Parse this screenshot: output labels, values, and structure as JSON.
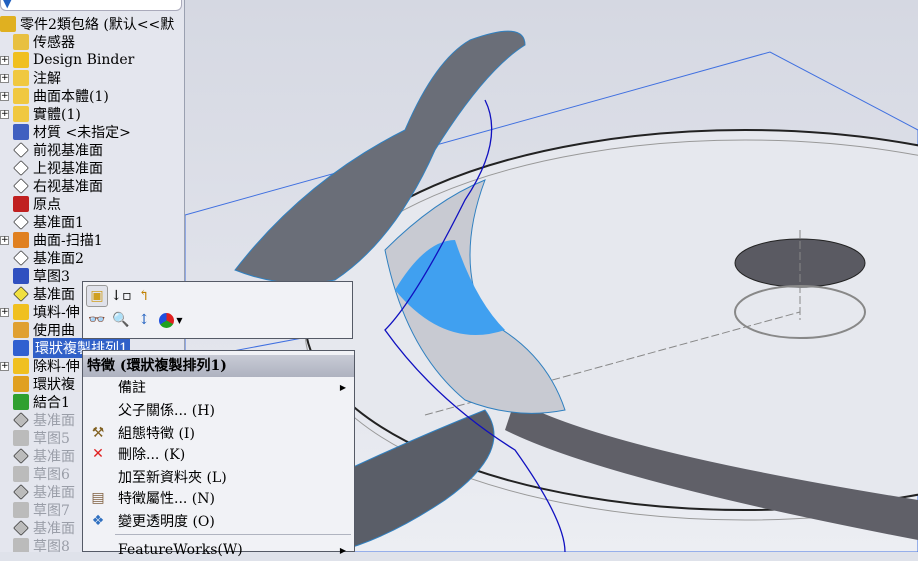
{
  "tree": {
    "root": "零件2類包絡 (默认<<默",
    "items": [
      {
        "label": "传感器",
        "plus": false,
        "icon": "sensor-icon",
        "color": "#e8c040"
      },
      {
        "label": "Design Binder",
        "plus": true,
        "icon": "design-binder-icon",
        "color": "#f0c020"
      },
      {
        "label": "注解",
        "plus": true,
        "icon": "annotations-icon",
        "color": "#f0c840"
      },
      {
        "label": "曲面本體(1)",
        "plus": true,
        "icon": "surface-bodies-icon",
        "color": "#f0c840"
      },
      {
        "label": "實體(1)",
        "plus": true,
        "icon": "solid-bodies-icon",
        "color": "#f0c840"
      },
      {
        "label": "材質 <未指定>",
        "plus": false,
        "icon": "material-icon",
        "color": "#4060c0"
      },
      {
        "label": "前视基准面",
        "plus": false,
        "icon": "plane-icon",
        "color": "#fff"
      },
      {
        "label": "上视基准面",
        "plus": false,
        "icon": "plane-icon",
        "color": "#fff"
      },
      {
        "label": "右视基准面",
        "plus": false,
        "icon": "plane-icon",
        "color": "#fff"
      },
      {
        "label": "原点",
        "plus": false,
        "icon": "origin-icon",
        "color": "#c02020"
      },
      {
        "label": "基准面1",
        "plus": false,
        "icon": "plane-icon",
        "color": "#fff"
      },
      {
        "label": "曲面-扫描1",
        "plus": true,
        "icon": "sweep-surface-icon",
        "color": "#e08020"
      },
      {
        "label": "基准面2",
        "plus": false,
        "icon": "plane-icon",
        "color": "#fff"
      },
      {
        "label": "草图3",
        "plus": false,
        "icon": "sketch-icon",
        "color": "#3050c0"
      },
      {
        "label": "基准面",
        "plus": false,
        "icon": "plane-icon",
        "color": "#f0e040"
      },
      {
        "label": "填料-伸",
        "plus": true,
        "icon": "boss-extrude-icon",
        "color": "#f0c020"
      },
      {
        "label": "使用曲",
        "plus": false,
        "icon": "thicken-icon",
        "color": "#e0a030"
      },
      {
        "label": "環狀複製排列1",
        "plus": false,
        "icon": "circular-pattern-icon",
        "color": "#3060d0",
        "selected": true
      },
      {
        "label": "除料-伸",
        "plus": true,
        "icon": "cut-extrude-icon",
        "color": "#f0c020"
      },
      {
        "label": "環狀複",
        "plus": false,
        "icon": "circular-pattern-icon",
        "color": "#e0a020"
      },
      {
        "label": "結合1",
        "plus": false,
        "icon": "combine-icon",
        "color": "#30a030"
      },
      {
        "label": "基准面",
        "plus": false,
        "icon": "plane-icon",
        "color": "#bbb",
        "dim": true
      },
      {
        "label": "草图5",
        "plus": false,
        "icon": "sketch-icon",
        "color": "#bbb",
        "dim": true
      },
      {
        "label": "基准面",
        "plus": false,
        "icon": "plane-icon",
        "color": "#bbb",
        "dim": true
      },
      {
        "label": "草图6",
        "plus": false,
        "icon": "sketch-icon",
        "color": "#bbb",
        "dim": true
      },
      {
        "label": "基准面",
        "plus": false,
        "icon": "plane-icon",
        "color": "#bbb",
        "dim": true
      },
      {
        "label": "草图7",
        "plus": false,
        "icon": "sketch-icon",
        "color": "#bbb",
        "dim": true
      },
      {
        "label": "基准面",
        "plus": false,
        "icon": "plane-icon",
        "color": "#bbb",
        "dim": true
      },
      {
        "label": "草图8",
        "plus": false,
        "icon": "sketch-icon",
        "color": "#bbb",
        "dim": true
      }
    ]
  },
  "context_menu": {
    "header": "特徵 (環狀複製排列1)",
    "items": [
      {
        "label": "備註",
        "icon": "",
        "submenu": true
      },
      {
        "label": "父子關係... (H)",
        "icon": ""
      },
      {
        "label": "組態特徵 (I)",
        "icon": "configure-feature-icon"
      },
      {
        "label": "刪除... (K)",
        "icon": "delete-icon"
      },
      {
        "label": "加至新資料夾 (L)",
        "icon": ""
      },
      {
        "label": "特徵屬性... (N)",
        "icon": "feature-properties-icon"
      },
      {
        "label": "變更透明度 (O)",
        "icon": "change-transparency-icon"
      },
      {
        "label": "FeatureWorks(W)",
        "icon": "",
        "submenu": true
      }
    ]
  },
  "colors": {
    "selection": "#3060c8",
    "highlight_face": "#40a0f0",
    "curve": "#1010c0"
  }
}
